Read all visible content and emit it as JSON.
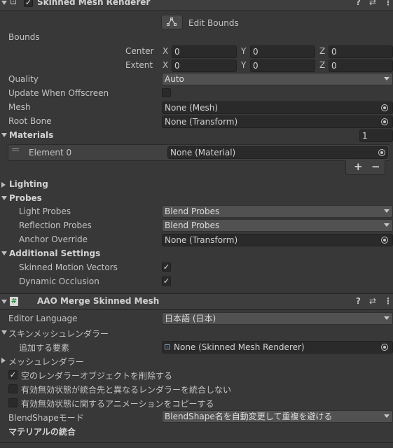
{
  "renderer": {
    "title": "Skinned Mesh Renderer",
    "edit_bounds": "Edit Bounds",
    "bounds_label": "Bounds",
    "center_label": "Center",
    "extent_label": "Extent",
    "axis_x": "X",
    "axis_y": "Y",
    "axis_z": "Z",
    "center": {
      "x": "0",
      "y": "0",
      "z": "0"
    },
    "extent": {
      "x": "0",
      "y": "0",
      "z": "0"
    },
    "quality_label": "Quality",
    "quality_value": "Auto",
    "update_offscreen_label": "Update When Offscreen",
    "mesh_label": "Mesh",
    "mesh_value": "None (Mesh)",
    "root_bone_label": "Root Bone",
    "root_bone_value": "None (Transform)",
    "materials_label": "Materials",
    "materials_count": "1",
    "element0_label": "Element 0",
    "element0_value": "None (Material)",
    "plus": "+",
    "minus": "−",
    "lighting_label": "Lighting",
    "probes_label": "Probes",
    "light_probes_label": "Light Probes",
    "light_probes_value": "Blend Probes",
    "reflection_probes_label": "Reflection Probes",
    "reflection_probes_value": "Blend Probes",
    "anchor_override_label": "Anchor Override",
    "anchor_override_value": "None (Transform)",
    "additional_label": "Additional Settings",
    "motion_vectors_label": "Skinned Motion Vectors",
    "dynamic_occlusion_label": "Dynamic Occlusion"
  },
  "aao": {
    "title": "AAO Merge Skinned Mesh",
    "editor_language_label": "Editor Language",
    "editor_language_value": "日本語 (日本)",
    "skinned_section": "スキンメッシュレンダラー",
    "add_element_label": "追加する要素",
    "add_element_value": "None (Skinned Mesh Renderer)",
    "mesh_renderer_section": "メッシュレンダラー",
    "remove_empty_label": "空のレンダラーオブジェクトを削除する",
    "merge_different_label": "有効無効状態が統合先と異なるレンダラーを統合しない",
    "copy_anim_label": "有効無効状態に関するアニメーションをコピーする",
    "blendshape_mode_label": "BlendShapeモード",
    "blendshape_mode_value": "BlendShape名を自動変更して重複を避ける",
    "material_merge_label": "マテリアルの統合"
  },
  "icons": {
    "check": "✓",
    "help": "?",
    "settings": "⇄",
    "menu": "⋮",
    "script": "#",
    "component": "⊡"
  },
  "colors": {
    "background": "#383838",
    "header": "#3e3e3e",
    "field": "#2a2a2a",
    "dropdown": "#515151"
  }
}
